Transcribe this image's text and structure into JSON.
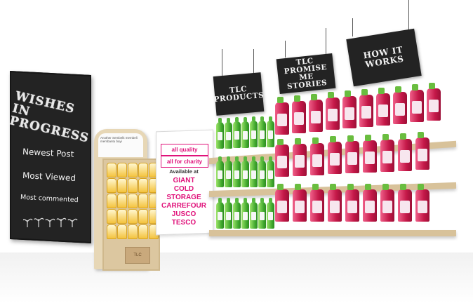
{
  "chalkboard": {
    "title": "WISHES IN PROGRESS",
    "links": [
      "Newest Post",
      "Most Viewed",
      "Most commented"
    ]
  },
  "poster": {
    "tag_quality": "all quality",
    "tag_charity": "all for charity",
    "available_label": "Available at",
    "stores": "GIANT\nCOLD STORAGE\nCARREFOUR\nJUSCO\nTESCO"
  },
  "stand": {
    "header_text": "Another Sembelit membeli membantu bayi",
    "box_text": "TLC"
  },
  "signs": {
    "products": "TLC\nPRODUCTS",
    "stories": "TLC PROMISE\nME STORIES",
    "how": "HOW IT\nWORKS"
  },
  "colors": {
    "accent_pink": "#e0127a",
    "chalkboard": "#232323",
    "bottle_red": "#c41848",
    "bottle_green": "#3ea72c"
  }
}
